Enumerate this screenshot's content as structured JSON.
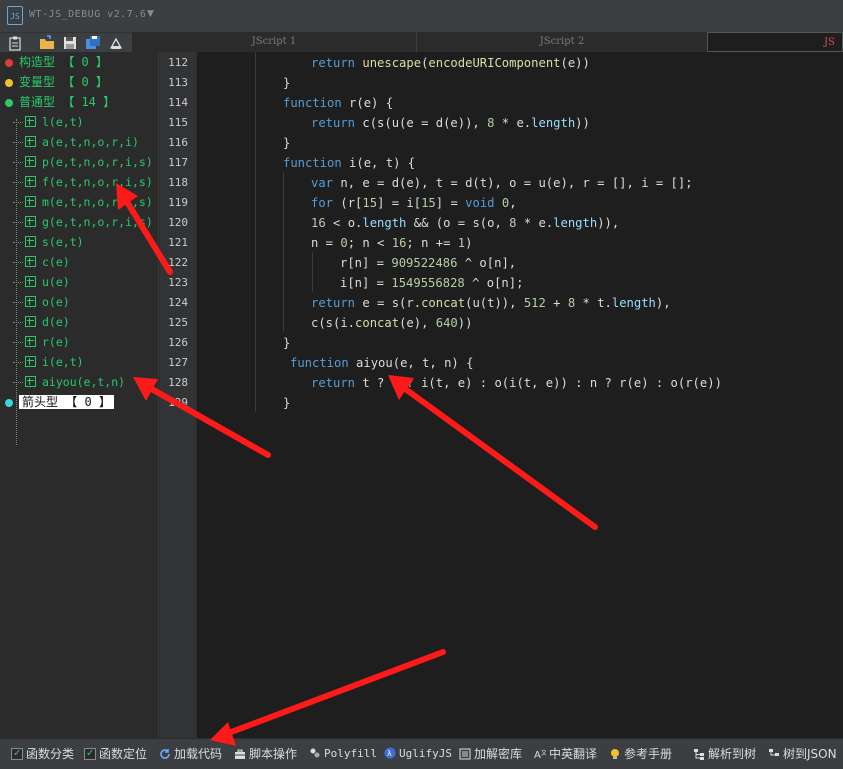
{
  "app": {
    "title": "WT-JS_DEBUG v2.7.6",
    "logo": "JS"
  },
  "tabs": [
    {
      "label": "JScript 1"
    },
    {
      "label": "JScript 2"
    },
    {
      "label": "JS"
    }
  ],
  "sidebar": {
    "categories": [
      {
        "label": "构造型 【 0 】",
        "color": "#e03a3a"
      },
      {
        "label": "变量型 【 0 】",
        "color": "#f2c12e"
      },
      {
        "label": "普通型 【 14 】",
        "color": "#29c96b"
      },
      {
        "label": "箭头型 【 0 】",
        "color": "#3ad6e0"
      }
    ],
    "functions": [
      "l(e,t)",
      "a(e,t,n,o,r,i)",
      "p(e,t,n,o,r,i,s)",
      "f(e,t,n,o,r,i,s)",
      "m(e,t,n,o,r,i,s)",
      "g(e,t,n,o,r,i,s)",
      "s(e,t)",
      "c(e)",
      "u(e)",
      "o(e)",
      "d(e)",
      "r(e)",
      "i(e,t)",
      "aiyou(e,t,n)"
    ]
  },
  "editor": {
    "line_numbers": [
      "112",
      "113",
      "114",
      "115",
      "116",
      "117",
      "118",
      "119",
      "120",
      "121",
      "122",
      "123",
      "124",
      "125",
      "126",
      "127",
      "128",
      "129"
    ],
    "lines": [
      "return unescape(encodeURIComponent(e))",
      "}",
      "function r(e) {",
      "return c(s(u(e = d(e)), 8 * e.length))",
      "}",
      "function i(e, t) {",
      "var n, e = d(e), t = d(t), o = u(e), r = [], i = [];",
      "for (r[15] = i[15] = void 0,",
      "16 < o.length && (o = s(o, 8 * e.length)),",
      "n = 0; n < 16; n += 1)",
      "r[n] = 909522486 ^ o[n],",
      "i[n] = 1549556828 ^ o[n];",
      "return e = s(r.concat(u(t)), 512 + 8 * t.length),",
      "c(s(i.concat(e), 640))",
      "}",
      "function aiyou(e, t, n) {",
      "return t ? n ? i(t, e) : o(i(t, e)) : n ? r(e) : o(r(e))",
      "}"
    ]
  },
  "statusbar": {
    "items": [
      {
        "label": "函数分类",
        "icon": "checkbox-icon"
      },
      {
        "label": "函数定位",
        "icon": "checkbox-icon"
      },
      {
        "label": "加载代码",
        "icon": "reload-icon"
      },
      {
        "label": "脚本操作",
        "icon": "toolbox-icon"
      },
      {
        "label": "Polyfill",
        "icon": "polyfill-icon"
      },
      {
        "label": "UglifyJS",
        "icon": "uglify-icon"
      },
      {
        "label": "加解密库",
        "icon": "crypto-icon"
      },
      {
        "label": "中英翻译",
        "icon": "translate-icon"
      },
      {
        "label": "参考手册",
        "icon": "lightbulb-icon"
      },
      {
        "label": "解析到树",
        "icon": "tree-icon"
      },
      {
        "label": "树到JSON",
        "icon": "json-icon"
      }
    ]
  }
}
